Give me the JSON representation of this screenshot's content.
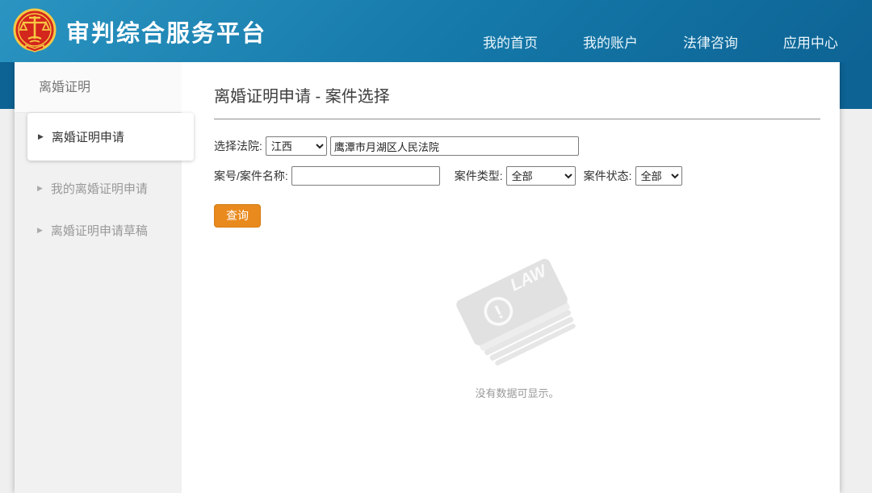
{
  "header": {
    "title": "审判综合服务平台",
    "nav": [
      {
        "label": "我的首页"
      },
      {
        "label": "我的账户"
      },
      {
        "label": "法律咨询"
      },
      {
        "label": "应用中心"
      }
    ]
  },
  "sidebar": {
    "title": "离婚证明",
    "items": [
      {
        "label": "离婚证明申请",
        "active": true
      },
      {
        "label": "我的离婚证明申请",
        "active": false
      },
      {
        "label": "离婚证明申请草稿",
        "active": false
      }
    ]
  },
  "main": {
    "page_title": "离婚证明申请 - 案件选择",
    "form": {
      "court_label": "选择法院:",
      "province_selected": "江西",
      "court_value": "鹰潭市月湖区人民法院",
      "case_label": "案号/案件名称:",
      "case_value": "",
      "type_label": "案件类型:",
      "type_selected": "全部",
      "status_label": "案件状态:",
      "status_selected": "全部",
      "search_button": "查询"
    },
    "empty": {
      "icon_text": "LAW",
      "icon_mark": "!",
      "message": "没有数据可显示。"
    }
  },
  "colors": {
    "header_top": "#2b94c1",
    "header_bottom": "#0d6394",
    "accent_orange": "#e98a1e",
    "emblem_red": "#d3261c",
    "emblem_gold": "#f7c843"
  }
}
